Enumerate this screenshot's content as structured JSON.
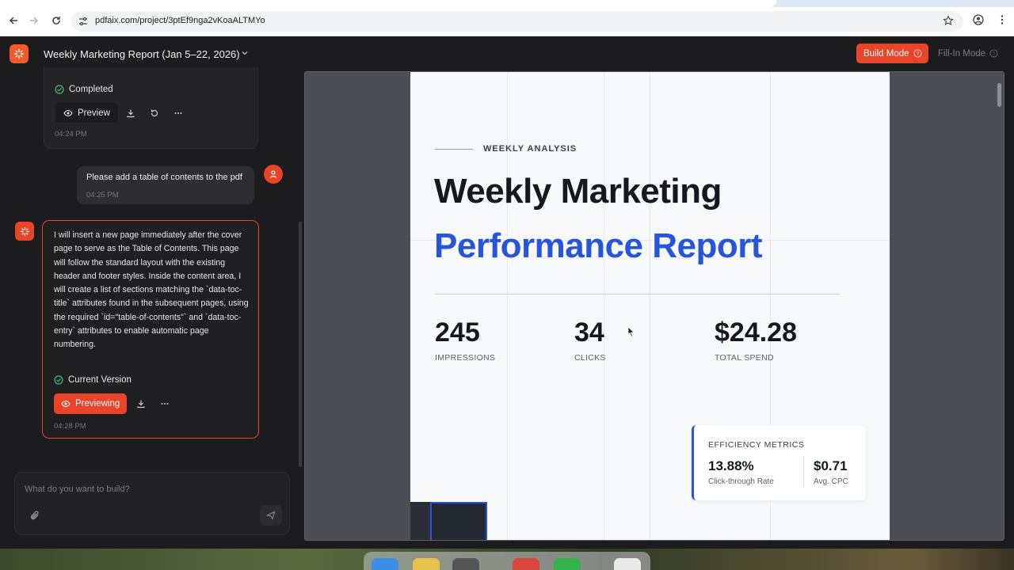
{
  "browser": {
    "url": "pdfaix.com/project/3ptEf9nga2vKoaALTMYo"
  },
  "header": {
    "project_title": "Weekly Marketing Report (Jan 5–22, 2026)",
    "build_mode_label": "Build Mode",
    "fill_in_mode_label": "Fill-In Mode"
  },
  "chat": {
    "previous_card": {
      "status": "Completed",
      "preview_label": "Preview",
      "time": "04:24 PM"
    },
    "user_message": {
      "text": "Please add a table of contents to the pdf",
      "time": "04:25 PM"
    },
    "assistant_message": {
      "text": "I will insert a new page immediately after the cover page to serve as the Table of Contents. This page will follow the standard layout with the existing header and footer styles. Inside the content area, I will create a list of sections matching the `data-toc-title` attributes found in the subsequent pages, using the required `id=\"table-of-contents\"` and `data-toc-entry` attributes to enable automatic page numbering.",
      "status": "Current Version",
      "previewing_label": "Previewing",
      "time": "04:28 PM"
    },
    "composer": {
      "placeholder": "What do you want to build?"
    }
  },
  "document": {
    "eyebrow": "WEEKLY ANALYSIS",
    "title_line1": "Weekly Marketing",
    "title_line2": "Performance Report",
    "stats": [
      {
        "value": "245",
        "label": "IMPRESSIONS"
      },
      {
        "value": "34",
        "label": "CLICKS"
      },
      {
        "value": "$24.28",
        "label": "TOTAL SPEND"
      }
    ],
    "efficiency": {
      "heading": "EFFICIENCY METRICS",
      "metric1_value": "13.88%",
      "metric1_label": "Click-through Rate",
      "metric2_value": "$0.71",
      "metric2_label": "Avg. CPC"
    }
  },
  "colors": {
    "accent": "#e8442a",
    "brand_blue": "#2754d8",
    "app_bg": "#1c1c1e"
  }
}
